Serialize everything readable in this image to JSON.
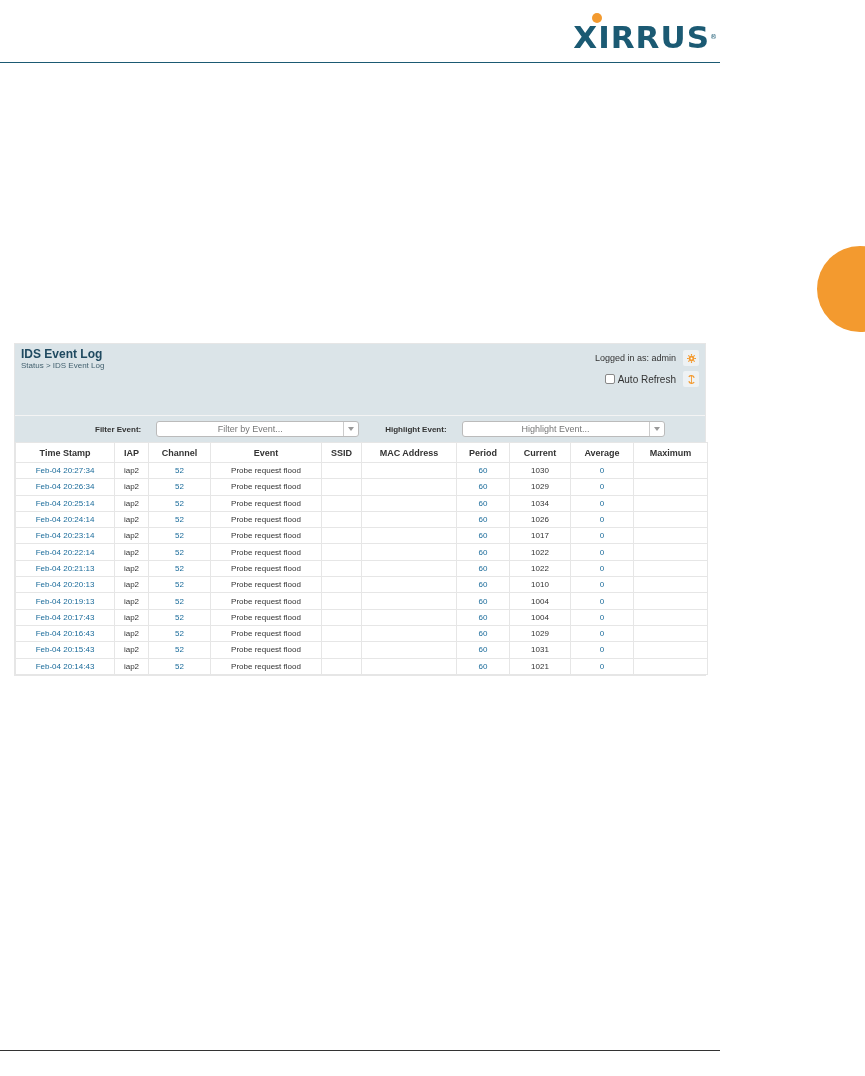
{
  "logo": {
    "text": "XIRRUS",
    "mark": "®"
  },
  "panel": {
    "title": "IDS Event Log",
    "breadcrumb": "Status > IDS Event Log",
    "logged_in": "Logged in as: admin",
    "auto_refresh": {
      "label": "Auto Refresh",
      "checked": false
    }
  },
  "filters": [
    {
      "label": "Filter Event:",
      "placeholder": "Filter by Event..."
    },
    {
      "label": "Highlight Event:",
      "placeholder": "Highlight Event..."
    }
  ],
  "table": {
    "columns": [
      "Time Stamp",
      "IAP",
      "Channel",
      "Event",
      "SSID",
      "MAC Address",
      "Period",
      "Current",
      "Average",
      "Maximum"
    ],
    "rows": [
      [
        "Feb-04 20:27:34",
        "iap2",
        "52",
        "Probe request flood",
        "",
        "",
        "60",
        "1030",
        "0",
        ""
      ],
      [
        "Feb-04 20:26:34",
        "iap2",
        "52",
        "Probe request flood",
        "",
        "",
        "60",
        "1029",
        "0",
        ""
      ],
      [
        "Feb-04 20:25:14",
        "iap2",
        "52",
        "Probe request flood",
        "",
        "",
        "60",
        "1034",
        "0",
        ""
      ],
      [
        "Feb-04 20:24:14",
        "iap2",
        "52",
        "Probe request flood",
        "",
        "",
        "60",
        "1026",
        "0",
        ""
      ],
      [
        "Feb-04 20:23:14",
        "iap2",
        "52",
        "Probe request flood",
        "",
        "",
        "60",
        "1017",
        "0",
        ""
      ],
      [
        "Feb-04 20:22:14",
        "iap2",
        "52",
        "Probe request flood",
        "",
        "",
        "60",
        "1022",
        "0",
        ""
      ],
      [
        "Feb-04 20:21:13",
        "iap2",
        "52",
        "Probe request flood",
        "",
        "",
        "60",
        "1022",
        "0",
        ""
      ],
      [
        "Feb-04 20:20:13",
        "iap2",
        "52",
        "Probe request flood",
        "",
        "",
        "60",
        "1010",
        "0",
        ""
      ],
      [
        "Feb-04 20:19:13",
        "iap2",
        "52",
        "Probe request flood",
        "",
        "",
        "60",
        "1004",
        "0",
        ""
      ],
      [
        "Feb-04 20:17:43",
        "iap2",
        "52",
        "Probe request flood",
        "",
        "",
        "60",
        "1004",
        "0",
        ""
      ],
      [
        "Feb-04 20:16:43",
        "iap2",
        "52",
        "Probe request flood",
        "",
        "",
        "60",
        "1029",
        "0",
        ""
      ],
      [
        "Feb-04 20:15:43",
        "iap2",
        "52",
        "Probe request flood",
        "",
        "",
        "60",
        "1031",
        "0",
        ""
      ],
      [
        "Feb-04 20:14:43",
        "iap2",
        "52",
        "Probe request flood",
        "",
        "",
        "60",
        "1021",
        "0",
        ""
      ]
    ]
  }
}
